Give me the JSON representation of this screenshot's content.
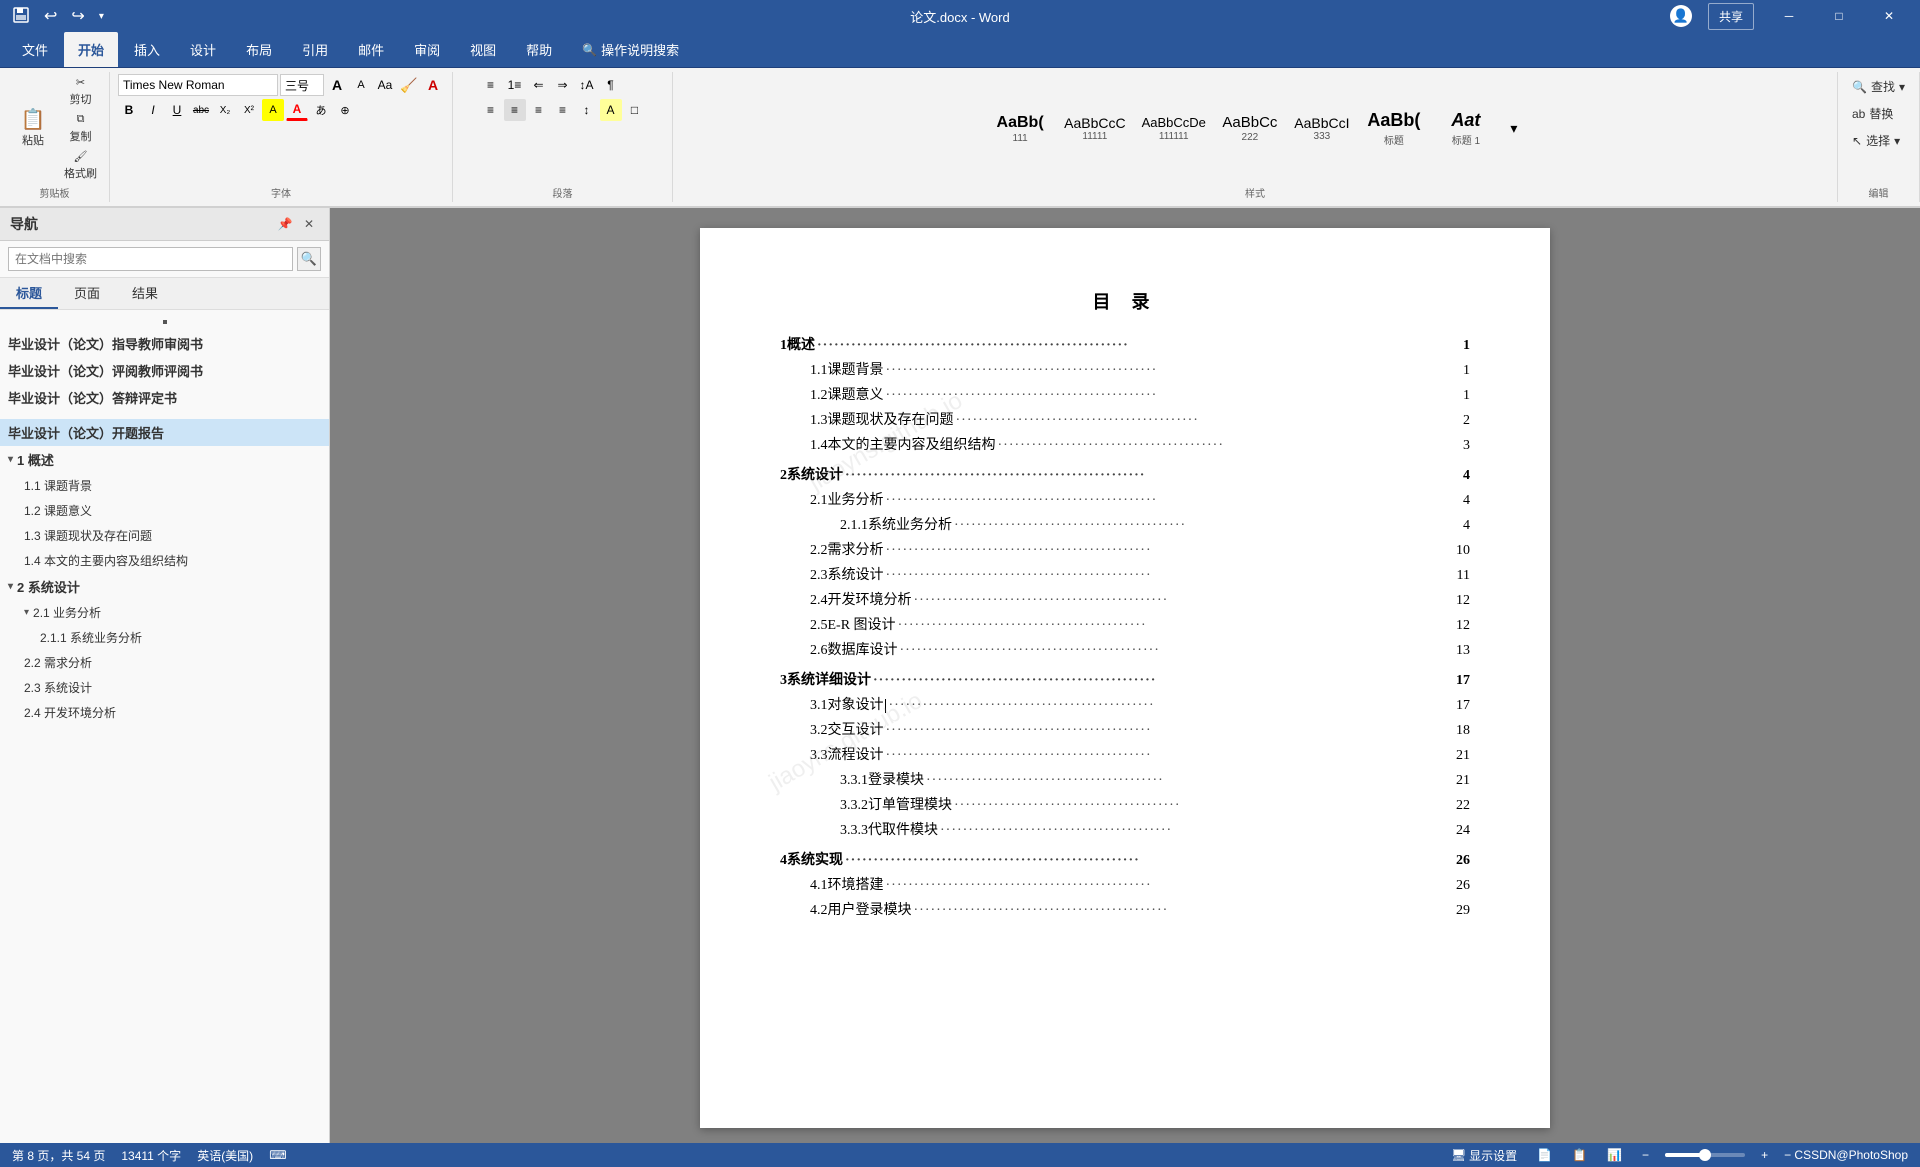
{
  "titlebar": {
    "filename": "论文.docx  -  Word",
    "minimize": "─",
    "restore": "□",
    "close": "✕",
    "user_icon": "👤",
    "share": "共享"
  },
  "ribbon": {
    "tabs": [
      "文件",
      "开始",
      "插入",
      "设计",
      "布局",
      "引用",
      "邮件",
      "审阅",
      "视图",
      "帮助",
      "操作说明搜索"
    ],
    "active_tab": "开始",
    "clipboard_group": "剪贴板",
    "font_group": "字体",
    "paragraph_group": "段落",
    "styles_group": "样式",
    "editing_group": "编辑",
    "paste_label": "粘贴",
    "cut_label": "剪切",
    "copy_label": "复制",
    "format_paint_label": "格式刷",
    "font_name": "Times New Roman",
    "font_size": "三号",
    "bold": "B",
    "italic": "I",
    "underline": "U",
    "strikethrough": "abc",
    "subscript": "X₂",
    "superscript": "X²",
    "find_label": "查找",
    "replace_label": "替换",
    "select_label": "选择",
    "styles": [
      {
        "name": "111",
        "label": "111"
      },
      {
        "name": "11111",
        "label": "11111"
      },
      {
        "name": "111111",
        "label": "111111"
      },
      {
        "name": "222",
        "label": "222"
      },
      {
        "name": "333",
        "label": "333"
      },
      {
        "name": "标题",
        "label": "标题"
      },
      {
        "name": "标题1",
        "label": "标题 1"
      }
    ]
  },
  "sidebar": {
    "title": "导航",
    "search_placeholder": "在文档中搜索",
    "tabs": [
      "标题",
      "页面",
      "结果"
    ],
    "active_tab": "标题",
    "items": [
      {
        "level": 1,
        "text": "毕业设计（论文）指导教师审阅书",
        "active": false
      },
      {
        "level": 1,
        "text": "毕业设计（论文）评阅教师评阅书",
        "active": false
      },
      {
        "level": 1,
        "text": "毕业设计（论文）答辩评定书",
        "active": false
      },
      {
        "level": 1,
        "text": "毕业设计（论文）开题报告",
        "active": true
      },
      {
        "level": 1,
        "text": "1 概述",
        "active": false,
        "expanded": true
      },
      {
        "level": 2,
        "text": "1.1 课题背景",
        "active": false
      },
      {
        "level": 2,
        "text": "1.2 课题意义",
        "active": false
      },
      {
        "level": 2,
        "text": "1.3 课题现状及存在问题",
        "active": false
      },
      {
        "level": 2,
        "text": "1.4 本文的主要内容及组织结构",
        "active": false
      },
      {
        "level": 1,
        "text": "2 系统设计",
        "active": false,
        "expanded": true
      },
      {
        "level": 2,
        "text": "2.1 业务分析",
        "active": false,
        "expanded": true
      },
      {
        "level": 3,
        "text": "2.1.1 系统业务分析",
        "active": false
      },
      {
        "level": 2,
        "text": "2.2 需求分析",
        "active": false
      },
      {
        "level": 2,
        "text": "2.3 系统设计",
        "active": false
      },
      {
        "level": 2,
        "text": "2.4 开发环境分析",
        "active": false
      }
    ]
  },
  "document": {
    "title": "目  录",
    "toc_entries": [
      {
        "level": 1,
        "num": "1",
        "text": " 概述",
        "page": "1"
      },
      {
        "level": 2,
        "num": "1.1",
        "text": " 课题背景",
        "page": "1"
      },
      {
        "level": 2,
        "num": "1.2",
        "text": " 课题意义",
        "page": "1"
      },
      {
        "level": 2,
        "num": "1.3",
        "text": " 课题现状及存在问题",
        "page": "2"
      },
      {
        "level": 2,
        "num": "1.4",
        "text": " 本文的主要内容及组织结构",
        "page": "3"
      },
      {
        "level": 1,
        "num": "2",
        "text": " 系统设计",
        "page": "4"
      },
      {
        "level": 2,
        "num": "2.1",
        "text": " 业务分析",
        "page": "4"
      },
      {
        "level": 3,
        "num": "2.1.1",
        "text": " 系统业务分析",
        "page": "4"
      },
      {
        "level": 2,
        "num": "2.2",
        "text": " 需求分析",
        "page": "10"
      },
      {
        "level": 2,
        "num": "2.3",
        "text": " 系统设计",
        "page": "11"
      },
      {
        "level": 2,
        "num": "2.4",
        "text": " 开发环境分析",
        "page": "12"
      },
      {
        "level": 2,
        "num": "2.5",
        "text": " E-R 图设计",
        "page": "12"
      },
      {
        "level": 2,
        "num": "2.6",
        "text": " 数据库设计",
        "page": "13"
      },
      {
        "level": 1,
        "num": "3",
        "text": " 系统详细设计",
        "page": "17"
      },
      {
        "level": 2,
        "num": "3.1",
        "text": " 对象设计",
        "page": "17",
        "has_cursor": true
      },
      {
        "level": 2,
        "num": "3.2",
        "text": " 交互设计",
        "page": "18"
      },
      {
        "level": 2,
        "num": "3.3",
        "text": " 流程设计",
        "page": "21"
      },
      {
        "level": 3,
        "num": "3.3.1",
        "text": " 登录模块",
        "page": "21"
      },
      {
        "level": 3,
        "num": "3.3.2",
        "text": " 订单管理模块",
        "page": "22"
      },
      {
        "level": 3,
        "num": "3.3.3",
        "text": " 代取件模块",
        "page": "24"
      },
      {
        "level": 1,
        "num": "4",
        "text": " 系统实现",
        "page": "26"
      },
      {
        "level": 2,
        "num": "4.1",
        "text": " 环境搭建",
        "page": "26"
      },
      {
        "level": 2,
        "num": "4.2",
        "text": " 用户登录模块",
        "page": "29"
      }
    ]
  },
  "statusbar": {
    "page_info": "第 8 页，共 54 页",
    "word_count": "13411 个字",
    "language": "英语(美国)",
    "display_settings": "显示设置",
    "view_icons": [
      "📄",
      "📋",
      "📊"
    ],
    "zoom": "100%"
  }
}
